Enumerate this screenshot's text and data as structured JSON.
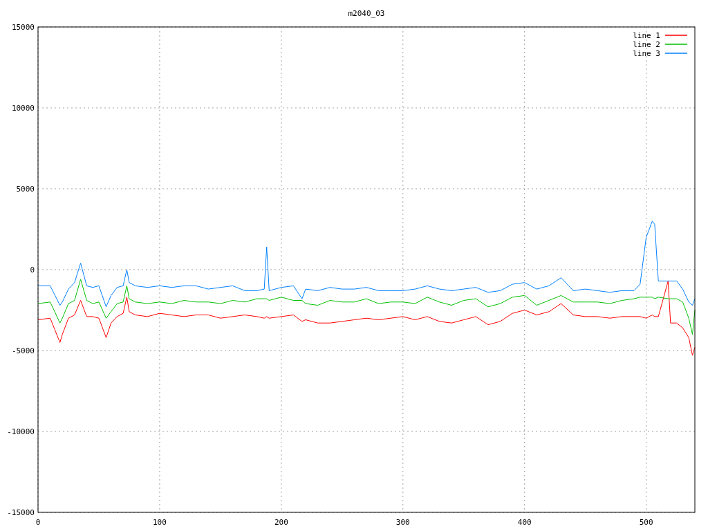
{
  "chart_data": {
    "type": "line",
    "title": "m2040_03",
    "grid": true,
    "legend": true,
    "xlim": [
      0,
      540
    ],
    "ylim": [
      -15000,
      15000
    ],
    "xticks": [
      0,
      100,
      200,
      300,
      400,
      500
    ],
    "yticks": [
      -15000,
      -10000,
      -5000,
      0,
      5000,
      10000,
      15000
    ],
    "x": [
      0,
      10,
      18,
      20,
      25,
      30,
      35,
      40,
      45,
      50,
      56,
      60,
      65,
      70,
      73,
      75,
      80,
      90,
      100,
      110,
      120,
      130,
      140,
      150,
      160,
      170,
      180,
      186,
      188,
      190,
      200,
      210,
      217,
      220,
      230,
      240,
      250,
      260,
      270,
      280,
      290,
      300,
      310,
      320,
      330,
      340,
      350,
      360,
      370,
      380,
      390,
      400,
      410,
      420,
      430,
      440,
      450,
      460,
      470,
      480,
      490,
      495,
      500,
      505,
      507,
      510,
      518,
      520,
      525,
      530,
      535,
      538,
      540
    ],
    "series": [
      {
        "name": "line 1",
        "color": "#ff0000",
        "values": [
          -3100,
          -3000,
          -4500,
          -4000,
          -3000,
          -2800,
          -1900,
          -2900,
          -2900,
          -3000,
          -4200,
          -3300,
          -2900,
          -2700,
          -1700,
          -2600,
          -2800,
          -2900,
          -2700,
          -2800,
          -2900,
          -2800,
          -2800,
          -3000,
          -2900,
          -2800,
          -2900,
          -3000,
          -2900,
          -3000,
          -2900,
          -2800,
          -3200,
          -3100,
          -3300,
          -3300,
          -3200,
          -3100,
          -3000,
          -3100,
          -3000,
          -2900,
          -3100,
          -2900,
          -3200,
          -3300,
          -3100,
          -2900,
          -3400,
          -3200,
          -2700,
          -2500,
          -2800,
          -2600,
          -2100,
          -2800,
          -2900,
          -2900,
          -3000,
          -2900,
          -2900,
          -2900,
          -3000,
          -2800,
          -2900,
          -2900,
          -700,
          -3300,
          -3300,
          -3600,
          -4200,
          -5300,
          -4800
        ]
      },
      {
        "name": "line 2",
        "color": "#00c000",
        "values": [
          -2100,
          -2000,
          -3300,
          -3000,
          -2100,
          -1900,
          -600,
          -1900,
          -2100,
          -2000,
          -3000,
          -2600,
          -2100,
          -2000,
          -1000,
          -1800,
          -2000,
          -2100,
          -2000,
          -2100,
          -1900,
          -2000,
          -2000,
          -2100,
          -1900,
          -2000,
          -1800,
          -1800,
          -1800,
          -1900,
          -1700,
          -1900,
          -1900,
          -2100,
          -2200,
          -1900,
          -2000,
          -2000,
          -1800,
          -2100,
          -2000,
          -2000,
          -2100,
          -1700,
          -2000,
          -2200,
          -1900,
          -1800,
          -2300,
          -2100,
          -1700,
          -1600,
          -2200,
          -1900,
          -1600,
          -2000,
          -2000,
          -2000,
          -2100,
          -1900,
          -1800,
          -1700,
          -1700,
          -1700,
          -1800,
          -1700,
          -1800,
          -1800,
          -1800,
          -2000,
          -3000,
          -4000,
          -2500
        ]
      },
      {
        "name": "line 3",
        "color": "#0080ff",
        "values": [
          -1000,
          -1000,
          -2200,
          -2000,
          -1200,
          -800,
          400,
          -1000,
          -1100,
          -1000,
          -2300,
          -1600,
          -1100,
          -1000,
          0,
          -800,
          -1000,
          -1100,
          -1000,
          -1100,
          -1000,
          -1000,
          -1200,
          -1100,
          -1000,
          -1300,
          -1300,
          -1200,
          1400,
          -1300,
          -1100,
          -1000,
          -1800,
          -1200,
          -1300,
          -1100,
          -1200,
          -1200,
          -1100,
          -1300,
          -1300,
          -1300,
          -1200,
          -1000,
          -1200,
          -1300,
          -1200,
          -1100,
          -1400,
          -1300,
          -900,
          -800,
          -1200,
          -1000,
          -500,
          -1300,
          -1200,
          -1300,
          -1400,
          -1300,
          -1300,
          -900,
          2000,
          3000,
          2800,
          -700,
          -700,
          -700,
          -700,
          -1200,
          -2000,
          -2200,
          -1800
        ]
      }
    ]
  }
}
